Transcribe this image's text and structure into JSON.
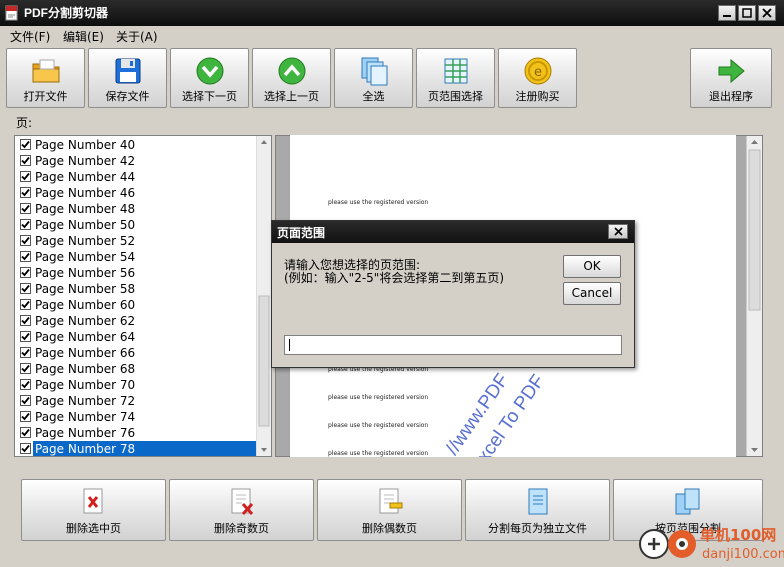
{
  "window": {
    "title": "PDF分割剪切器"
  },
  "menu": [
    {
      "label": "文件(F)"
    },
    {
      "label": "编辑(E)"
    },
    {
      "label": "关于(A)"
    }
  ],
  "toolbar": [
    {
      "label": "打开文件",
      "icon": "folder-icon"
    },
    {
      "label": "保存文件",
      "icon": "floppy-disk-icon"
    },
    {
      "label": "选择下一页",
      "icon": "green-down-arrow-icon"
    },
    {
      "label": "选择上一页",
      "icon": "green-up-arrow-icon"
    },
    {
      "label": "全选",
      "icon": "select-all-pages-icon"
    },
    {
      "label": "页范围选择",
      "icon": "page-range-grid-icon"
    },
    {
      "label": "注册购买",
      "icon": "gold-coin-icon"
    },
    {
      "label": "退出程序",
      "icon": "green-right-arrow-icon"
    }
  ],
  "pages_label": "页:",
  "pages": [
    {
      "label": "Page Number 40",
      "checked": true,
      "selected": false
    },
    {
      "label": "Page Number 42",
      "checked": true,
      "selected": false
    },
    {
      "label": "Page Number 44",
      "checked": true,
      "selected": false
    },
    {
      "label": "Page Number 46",
      "checked": true,
      "selected": false
    },
    {
      "label": "Page Number 48",
      "checked": true,
      "selected": false
    },
    {
      "label": "Page Number 50",
      "checked": true,
      "selected": false
    },
    {
      "label": "Page Number 52",
      "checked": true,
      "selected": false
    },
    {
      "label": "Page Number 54",
      "checked": true,
      "selected": false
    },
    {
      "label": "Page Number 56",
      "checked": true,
      "selected": false
    },
    {
      "label": "Page Number 58",
      "checked": true,
      "selected": false
    },
    {
      "label": "Page Number 60",
      "checked": true,
      "selected": false
    },
    {
      "label": "Page Number 62",
      "checked": true,
      "selected": false
    },
    {
      "label": "Page Number 64",
      "checked": true,
      "selected": false
    },
    {
      "label": "Page Number 66",
      "checked": true,
      "selected": false
    },
    {
      "label": "Page Number 68",
      "checked": true,
      "selected": false
    },
    {
      "label": "Page Number 70",
      "checked": true,
      "selected": false
    },
    {
      "label": "Page Number 72",
      "checked": true,
      "selected": false
    },
    {
      "label": "Page Number 74",
      "checked": true,
      "selected": false
    },
    {
      "label": "Page Number 76",
      "checked": true,
      "selected": false
    },
    {
      "label": "Page Number 78",
      "checked": true,
      "selected": true
    }
  ],
  "preview": {
    "reg_lines": [
      "please use the registered version",
      "please use the registered version",
      "please use the registered version",
      "please use the registered version",
      "please use the registered version"
    ],
    "watermark_1": "//www.PDF",
    "watermark_2": "Excel To PDF"
  },
  "bottom_buttons": [
    {
      "label": "删除选中页",
      "icon": "delete-selected-pages-icon"
    },
    {
      "label": "删除奇数页",
      "icon": "delete-odd-pages-icon"
    },
    {
      "label": "删除偶数页",
      "icon": "delete-even-pages-icon"
    },
    {
      "label": "分割每页为独立文件",
      "icon": "split-pages-icon"
    },
    {
      "label": "按页范围分割",
      "icon": "split-by-range-icon"
    }
  ],
  "dialog": {
    "title": "页面范围",
    "prompt": "请输入您想选择的页范围:",
    "example": "(例如：输入\"2-5\"将会选择第二到第五页)",
    "ok": "OK",
    "cancel": "Cancel",
    "input_value": ""
  },
  "site_watermark": {
    "name": "单机100网",
    "url": "danji100.com"
  },
  "colors": {
    "selection": "#0a68c9",
    "title_bar": "#1a1a1a",
    "watermark": "#3a57c9"
  }
}
